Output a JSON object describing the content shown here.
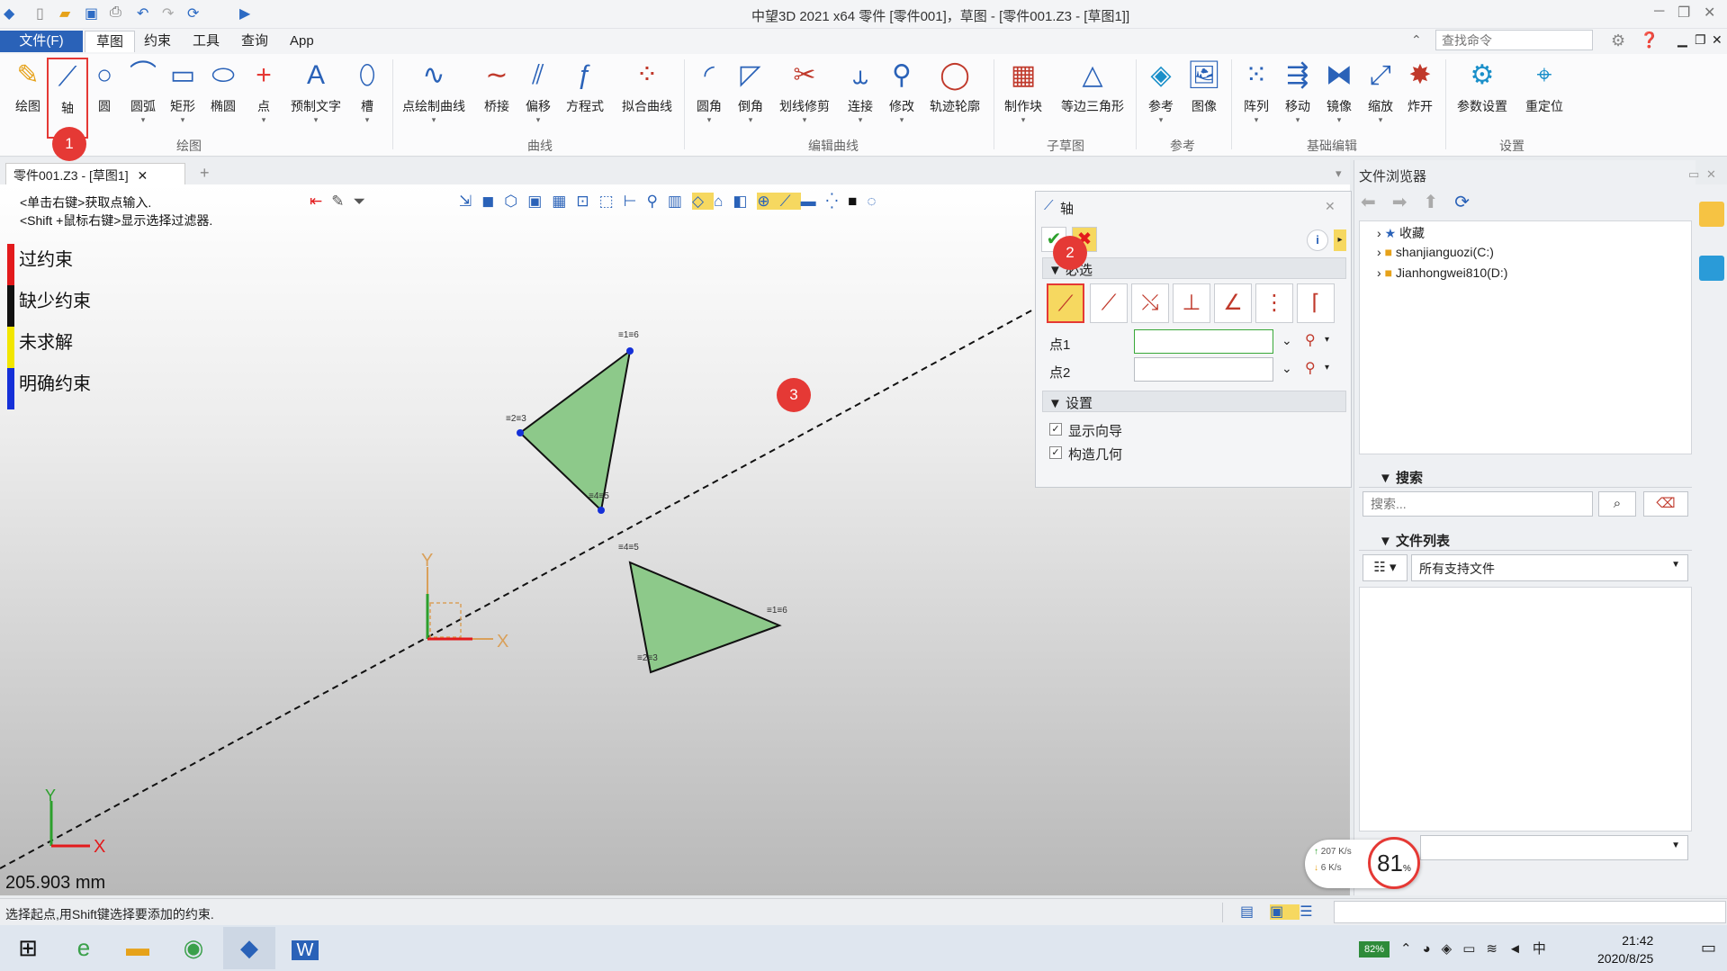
{
  "window": {
    "title": "中望3D 2021 x64      零件 [零件001]，草图 - [零件001.Z3 - [草图1]]",
    "min": "─",
    "restore": "❐",
    "close": "✕"
  },
  "menu": {
    "file": "文件(F)",
    "tabs": [
      "草图",
      "约束",
      "工具",
      "查询",
      "App"
    ],
    "search_placeholder": "查找命令"
  },
  "ribbon": {
    "draw": [
      "绘图",
      "轴",
      "圆",
      "圆弧",
      "矩形",
      "椭圆",
      "点",
      "预制文字",
      "槽"
    ],
    "curve": [
      "点绘制曲线",
      "桥接",
      "偏移",
      "方程式",
      "拟合曲线"
    ],
    "edit": [
      "圆角",
      "倒角",
      "划线修剪",
      "连接",
      "修改",
      "轨迹轮廓"
    ],
    "sub": [
      "制作块",
      "等边三角形"
    ],
    "ref": [
      "参考",
      "图像"
    ],
    "basic": [
      "阵列",
      "移动",
      "镜像",
      "缩放",
      "炸开"
    ],
    "settings": [
      "参数设置",
      "重定位"
    ],
    "groups": [
      "绘图",
      "曲线",
      "编辑曲线",
      "子草图",
      "参考",
      "基础编辑",
      "设置"
    ]
  },
  "doc_tab": "零件001.Z3 - [草图1]",
  "canvas": {
    "hint1": "<单击右键>获取点输入.",
    "hint2": "<Shift +鼠标右键>显示选择过滤器.",
    "legend": [
      {
        "label": "过约束",
        "color": "#e31a1c"
      },
      {
        "label": "缺少约束",
        "color": "#111111"
      },
      {
        "label": "未求解",
        "color": "#f2e600"
      },
      {
        "label": "明确约束",
        "color": "#1530d8"
      }
    ],
    "measure": "205.903 mm",
    "axis_x": "X",
    "axis_y": "Y",
    "tri1_labels": [
      "1",
      "6",
      "2",
      "3",
      "4",
      "5"
    ],
    "tri2_labels": [
      "4",
      "5",
      "1",
      "6",
      "2",
      "3"
    ]
  },
  "prop_panel": {
    "title": "轴",
    "section_required": "必选",
    "point1": "点1",
    "point2": "点2",
    "section_settings": "设置",
    "show_guide": "显示向导",
    "construct_geom": "构造几何"
  },
  "file_browser": {
    "title": "文件浏览器",
    "tree": [
      "收藏",
      "shanjianguozi(C:)",
      "Jianhongwei810(D:)"
    ],
    "search_section": "搜索",
    "search_placeholder": "搜索...",
    "file_list_section": "文件列表",
    "file_filter": "所有支持文件"
  },
  "status": {
    "text": "选择起点,用Shift键选择要添加的约束."
  },
  "network": {
    "up": "207 K/s",
    "down": "6  K/s",
    "percent": "81",
    "percent_sign": "%"
  },
  "taskbar": {
    "battery": "82%",
    "time": "21:42",
    "date": "2020/8/25"
  },
  "annotations": [
    "1",
    "2",
    "3"
  ]
}
